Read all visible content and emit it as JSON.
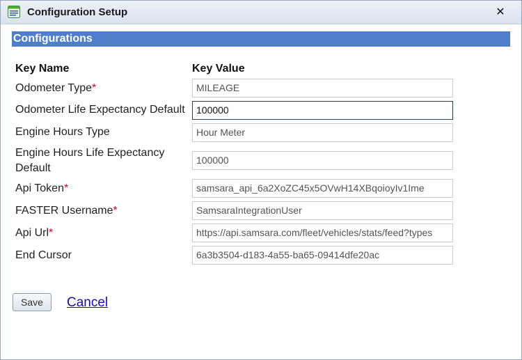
{
  "window": {
    "title": "Configuration Setup",
    "close_glyph": "✕"
  },
  "section": {
    "title": "Configurations"
  },
  "columns": {
    "key_name": "Key Name",
    "key_value": "Key Value"
  },
  "rows": [
    {
      "label": "Odometer Type",
      "required": "*",
      "value": "MILEAGE"
    },
    {
      "label": "Odometer Life Expectancy Default",
      "required": "",
      "value": "100000"
    },
    {
      "label": "Engine Hours Type",
      "required": "",
      "value": "Hour Meter"
    },
    {
      "label_line1": "Engine Hours Life Expectancy",
      "label_line2": "Default",
      "required": "",
      "value": "100000"
    },
    {
      "label": "Api Token",
      "required": "*",
      "value": "samsara_api_6a2XoZC45x5OVwH14XBqoioyIv1Ime"
    },
    {
      "label": "FASTER Username",
      "required": "*",
      "value": "SamsaraIntegrationUser"
    },
    {
      "label": "Api Url",
      "required": "*",
      "value": "https://api.samsara.com/fleet/vehicles/stats/feed?types"
    },
    {
      "label": "End Cursor",
      "required": "",
      "value": "6a3b3504-d183-4a55-ba65-09414dfe20ac"
    }
  ],
  "actions": {
    "save_label": "Save",
    "cancel_label": "Cancel"
  },
  "colors": {
    "header_bar": "#4f7ecb",
    "required_marker": "#d0021b",
    "link": "#1a0dab"
  },
  "icons": {
    "app": "window-list-icon",
    "close": "close-icon"
  }
}
